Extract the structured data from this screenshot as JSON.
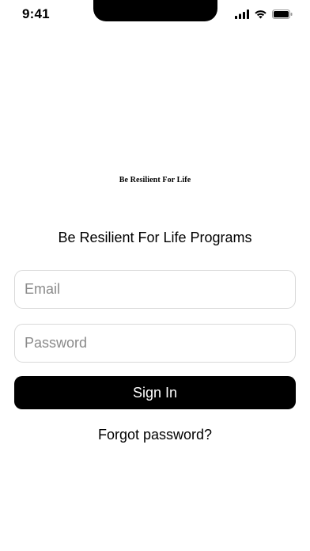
{
  "status_bar": {
    "time": "9:41",
    "icons": [
      "cellular-signal-icon",
      "wifi-icon",
      "battery-icon"
    ]
  },
  "logo": {
    "text": "Be Resilient For Life"
  },
  "heading": "Be Resilient For Life Programs",
  "form": {
    "email": {
      "value": "",
      "placeholder": "Email"
    },
    "password": {
      "value": "",
      "placeholder": "Password"
    },
    "sign_in_label": "Sign In",
    "forgot_password_label": "Forgot password?"
  },
  "colors": {
    "background": "#ffffff",
    "primary_button": "#000000",
    "primary_button_text": "#ffffff",
    "input_border": "#d9d9d9",
    "placeholder": "#8a8a8a"
  }
}
